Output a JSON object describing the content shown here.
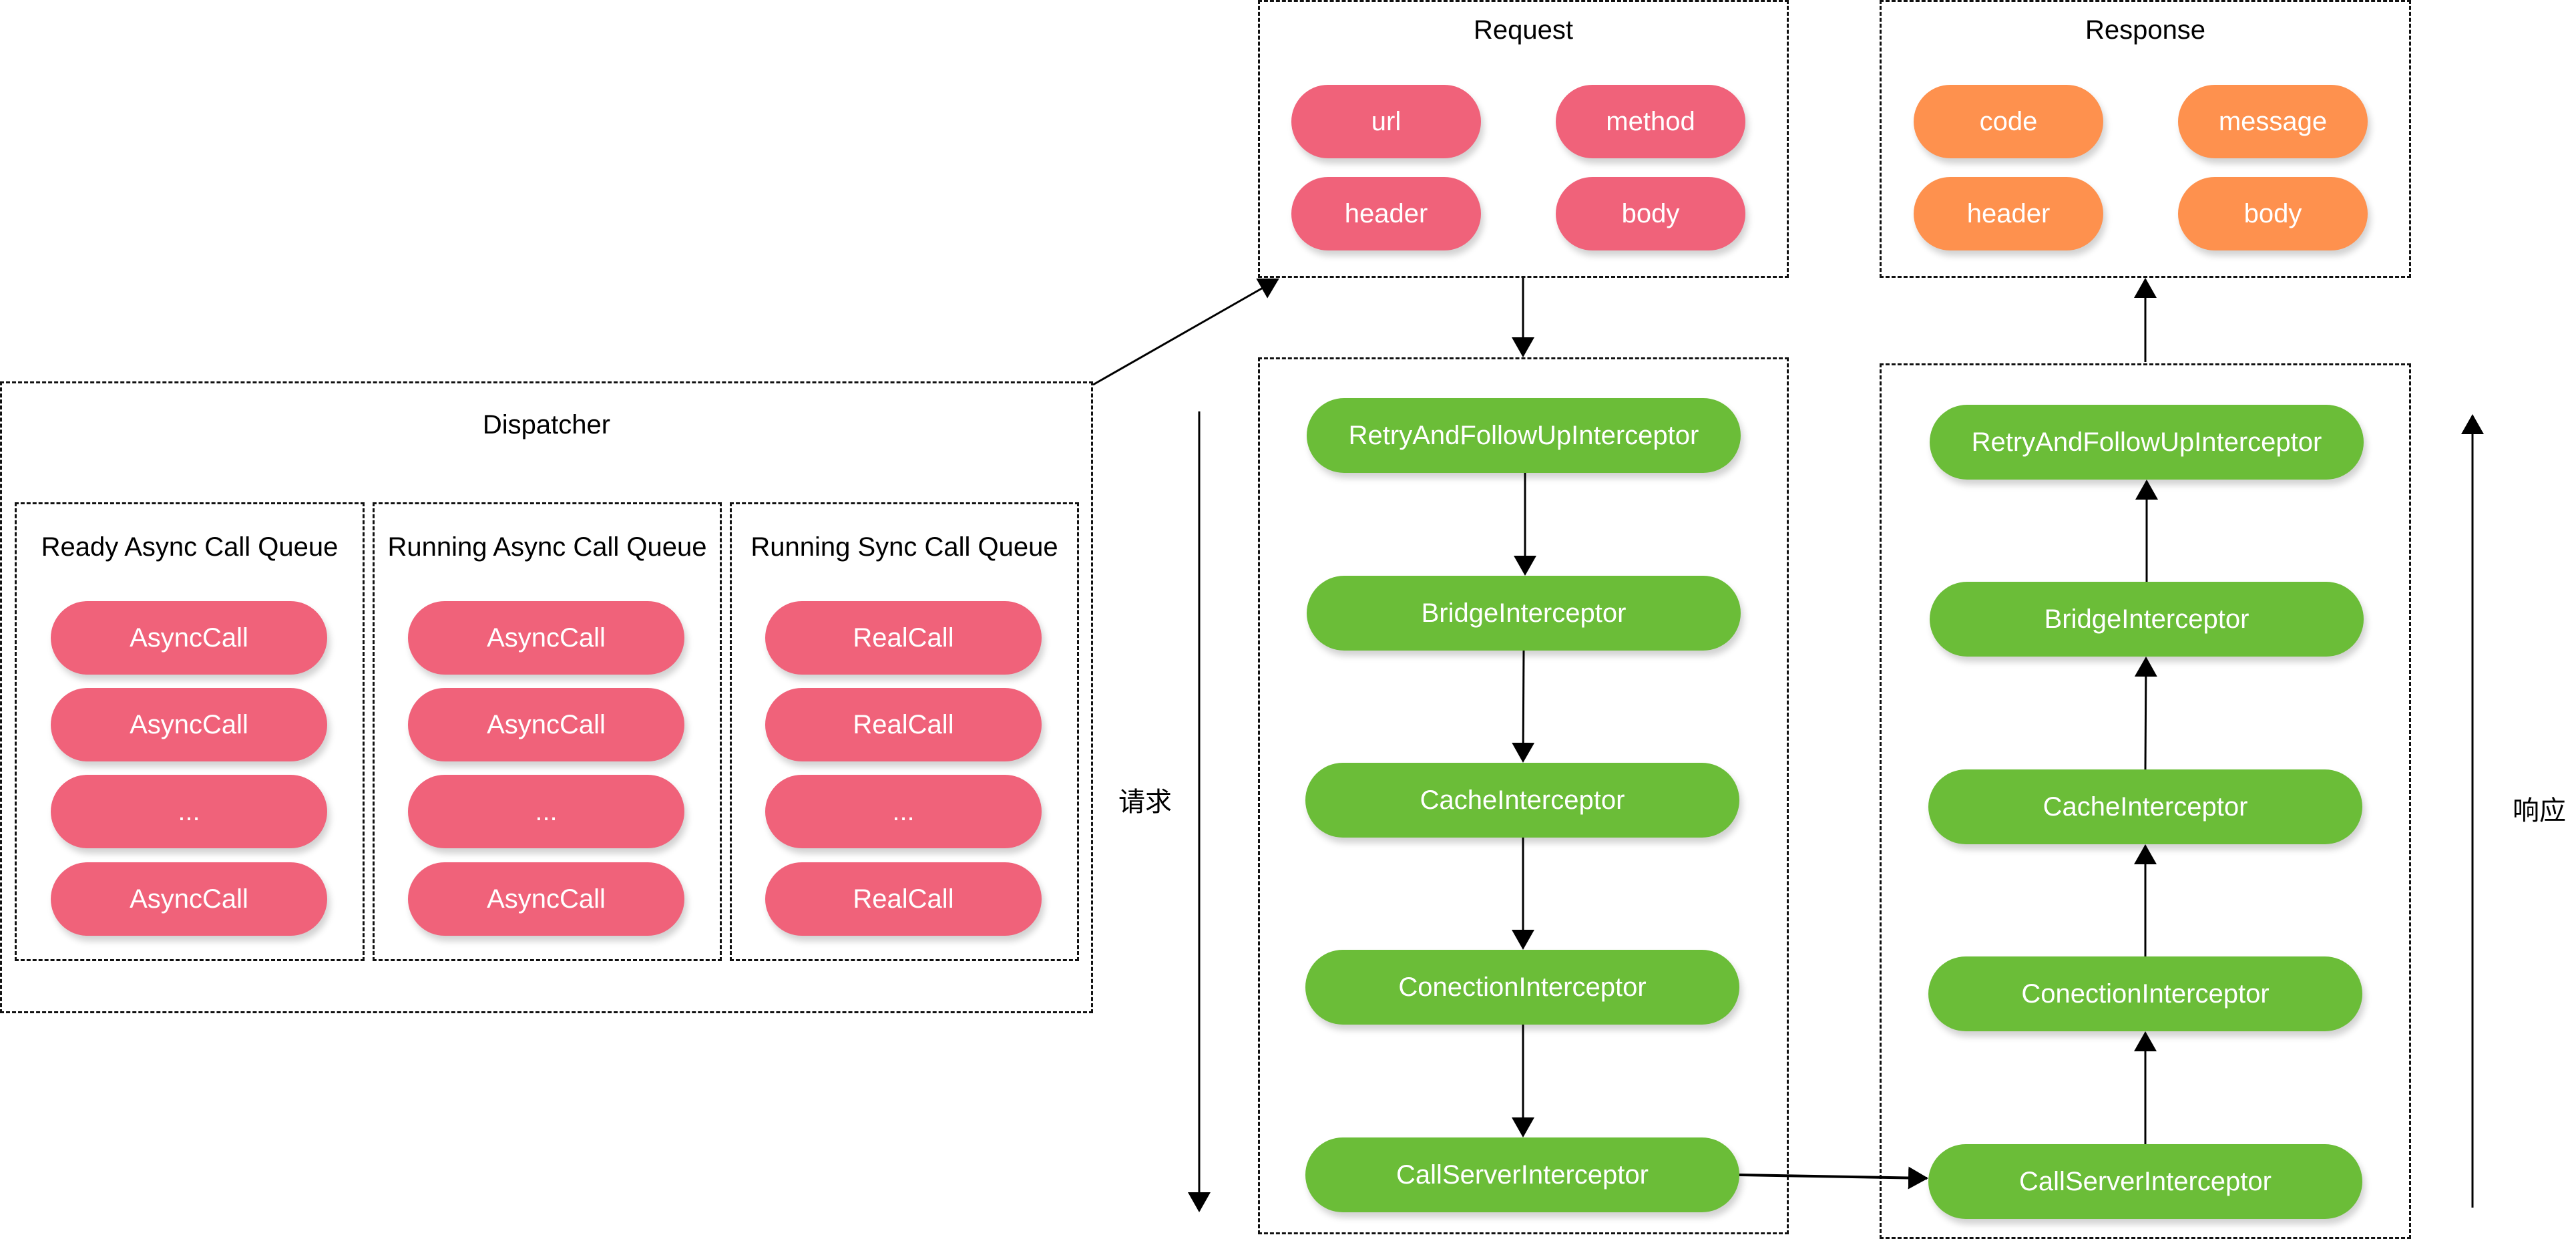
{
  "dispatcher": {
    "title": "Dispatcher",
    "queues": [
      {
        "title": "Ready Async Call Queue",
        "items": [
          "AsyncCall",
          "AsyncCall",
          "...",
          "AsyncCall"
        ]
      },
      {
        "title": "Running Async Call Queue",
        "items": [
          "AsyncCall",
          "AsyncCall",
          "...",
          "AsyncCall"
        ]
      },
      {
        "title": "Running Sync Call Queue",
        "items": [
          "RealCall",
          "RealCall",
          "...",
          "RealCall"
        ]
      }
    ]
  },
  "request": {
    "title": "Request",
    "fields": [
      "url",
      "method",
      "header",
      "body"
    ]
  },
  "response": {
    "title": "Response",
    "fields": [
      "code",
      "message",
      "header",
      "body"
    ]
  },
  "request_chain": [
    "RetryAndFollowUpInterceptor",
    "BridgeInterceptor",
    "CacheInterceptor",
    "ConectionInterceptor",
    "CallServerInterceptor"
  ],
  "response_chain": [
    "RetryAndFollowUpInterceptor",
    "BridgeInterceptor",
    "CacheInterceptor",
    "ConectionInterceptor",
    "CallServerInterceptor"
  ],
  "labels": {
    "request_direction": "请求",
    "response_direction": "响应"
  },
  "colors": {
    "call_pill": "#f0627a",
    "response_pill": "#fe914e",
    "interceptor_pill": "#6bbd38"
  }
}
